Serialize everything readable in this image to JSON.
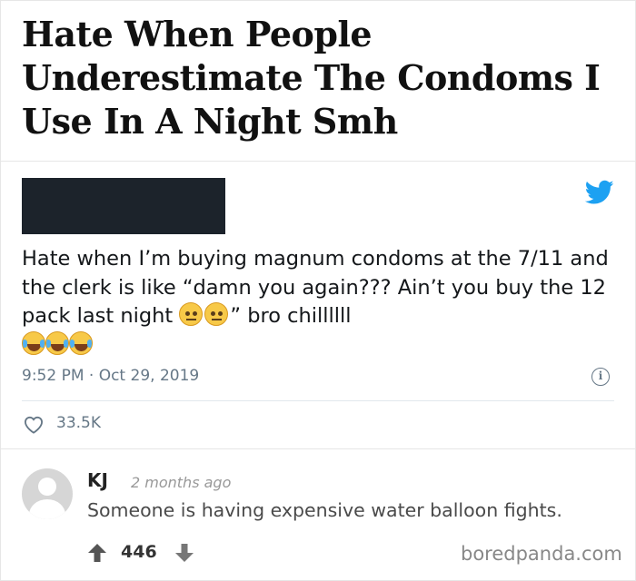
{
  "headline": "Hate When People Underestimate The Condoms I Use In A Night Smh",
  "tweet": {
    "text_part1": "Hate when I’m buying magnum condoms at the 7/11 and the clerk is like “damn you again??? Ain’t you buy the 12 pack last night ",
    "text_part2": "” bro chillllll",
    "emojis_inline": [
      "face-with-raised-eyebrow",
      "face-with-raised-eyebrow"
    ],
    "emojis_trailing": [
      "face-with-tears-of-joy",
      "face-with-tears-of-joy",
      "face-with-tears-of-joy"
    ],
    "timestamp": "9:52 PM · Oct 29, 2019",
    "likes": "33.5K",
    "icons": {
      "brand": "twitter-bird-icon",
      "info": "info-icon",
      "like": "heart-icon"
    },
    "colors": {
      "twitter_blue": "#1da1f2",
      "meta_gray": "#657786"
    }
  },
  "comment": {
    "author": "KJ",
    "time": "2 months ago",
    "text": "Someone is having expensive water balloon fights.",
    "votes": "446"
  },
  "watermark": "boredpanda.com"
}
